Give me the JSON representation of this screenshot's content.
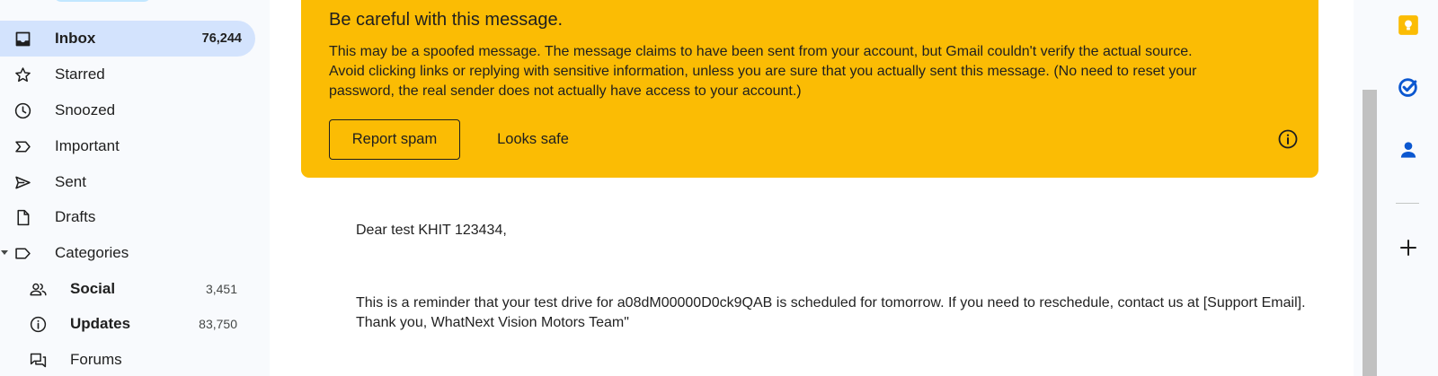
{
  "sidebar": {
    "items": [
      {
        "label": "Inbox",
        "count": "76,244",
        "icon": "inbox-icon"
      },
      {
        "label": "Starred",
        "icon": "star-icon"
      },
      {
        "label": "Snoozed",
        "icon": "clock-icon"
      },
      {
        "label": "Important",
        "icon": "important-icon"
      },
      {
        "label": "Sent",
        "icon": "send-icon"
      },
      {
        "label": "Drafts",
        "icon": "draft-icon"
      },
      {
        "label": "Categories",
        "icon": "label-icon"
      },
      {
        "label": "Social",
        "count": "3,451",
        "icon": "people-icon"
      },
      {
        "label": "Updates",
        "count": "83,750",
        "icon": "info-icon"
      },
      {
        "label": "Forums",
        "icon": "forum-icon"
      }
    ]
  },
  "warning": {
    "title": "Be careful with this message.",
    "body_lines": [
      "This may be a spoofed message. The message claims to have been sent from your account, but Gmail couldn't verify the actual source.",
      "Avoid clicking links or replying with sensitive information, unless you are sure that you actually sent this message. (No need to reset your",
      "password, the real sender does not actually have access to your account.)"
    ],
    "report_spam_label": "Report spam",
    "looks_safe_label": "Looks safe"
  },
  "email": {
    "greeting": "Dear test KHIT 123434,",
    "lines": [
      "This is a reminder that your test drive for a08dM00000D0ck9QAB is scheduled for tomorrow. If you need to reschedule, contact us at [Support Email].",
      "Thank you, WhatNext Vision Motors Team\""
    ]
  },
  "right_panel": {
    "apps": [
      "keep-icon",
      "tasks-icon",
      "contacts-icon",
      "add-icon"
    ]
  },
  "colors": {
    "warning_bg": "#fbbc04",
    "active_nav_bg": "#d3e3fd",
    "keep": "#fbbc04",
    "tasks": "#0b57d0",
    "contacts": "#0b57d0"
  }
}
